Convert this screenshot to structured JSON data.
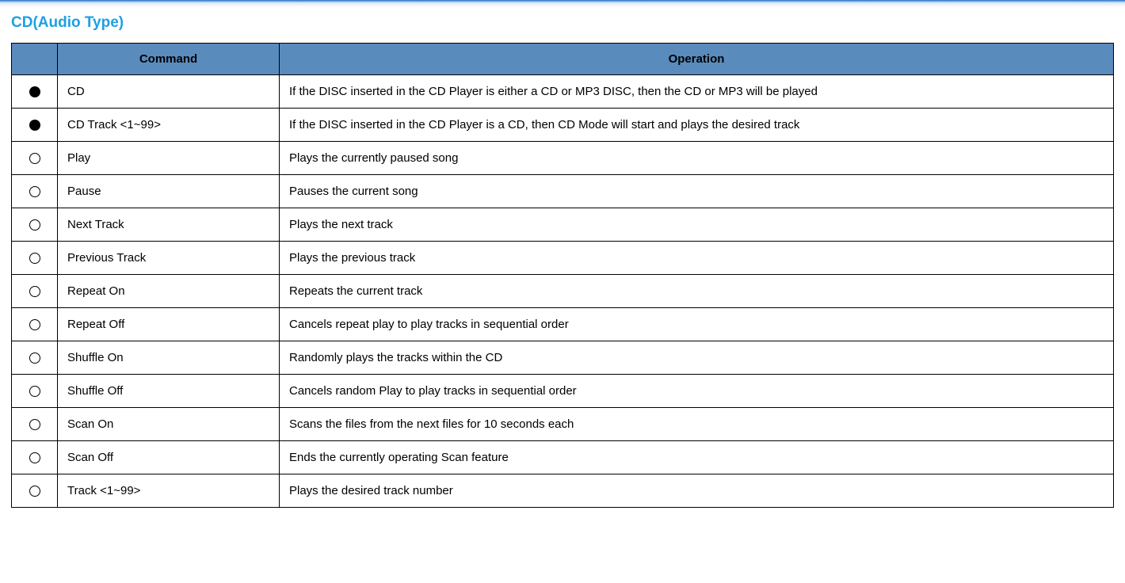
{
  "section": {
    "title": "CD(Audio Type)"
  },
  "table": {
    "headers": {
      "marker": "",
      "command": "Command",
      "operation": "Operation"
    },
    "rows": [
      {
        "marker": "filled",
        "command": "CD",
        "operation": "If the DISC inserted in the CD Player is either a CD or MP3 DISC, then the CD or MP3 will be played"
      },
      {
        "marker": "filled",
        "command": "CD Track <1~99>",
        "operation": "If the DISC inserted in the CD Player is a CD, then CD Mode will start and plays the desired track"
      },
      {
        "marker": "hollow",
        "command": "Play",
        "operation": "Plays the currently paused song"
      },
      {
        "marker": "hollow",
        "command": "Pause",
        "operation": "Pauses the current song"
      },
      {
        "marker": "hollow",
        "command": "Next Track",
        "operation": "Plays the next track"
      },
      {
        "marker": "hollow",
        "command": "Previous Track",
        "operation": "Plays the previous track"
      },
      {
        "marker": "hollow",
        "command": "Repeat On",
        "operation": "Repeats the current track"
      },
      {
        "marker": "hollow",
        "command": "Repeat Off",
        "operation": "Cancels repeat play to play tracks in sequential order"
      },
      {
        "marker": "hollow",
        "command": "Shuffle On",
        "operation": "Randomly plays the tracks within the CD"
      },
      {
        "marker": "hollow",
        "command": "Shuffle Off",
        "operation": "Cancels random Play to play tracks in sequential order"
      },
      {
        "marker": "hollow",
        "command": "Scan On",
        "operation": "Scans the files from the next files for 10 seconds each"
      },
      {
        "marker": "hollow",
        "command": "Scan Off",
        "operation": "Ends the currently operating Scan feature"
      },
      {
        "marker": "hollow",
        "command": "Track <1~99>",
        "operation": "Plays the desired track number"
      }
    ]
  }
}
